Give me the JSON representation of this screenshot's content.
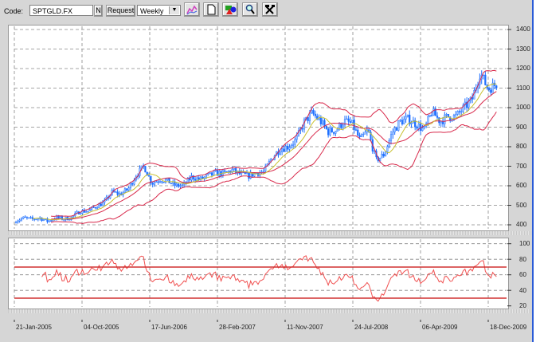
{
  "toolbar": {
    "code_label": "Code:",
    "code_value": "SPTGLD.FX",
    "n_button": "N",
    "request_button": "Request",
    "interval_value": "Weekly",
    "icons": [
      "indicator-chart-icon",
      "new-page-icon",
      "color-shapes-icon",
      "zoom-icon",
      "tools-icon"
    ]
  },
  "price_axis": {
    "ticks": [
      "1400",
      "1300",
      "1200",
      "1100",
      "1000",
      "900",
      "800",
      "700",
      "600",
      "500",
      "400"
    ]
  },
  "rsi_axis": {
    "ticks": [
      "100",
      "80",
      "60",
      "40",
      "20"
    ]
  },
  "date_axis": {
    "ticks": [
      "21-Jan-2005",
      "04-Oct-2005",
      "17-Jun-2006",
      "28-Feb-2007",
      "11-Nov-2007",
      "24-Jul-2008",
      "06-Apr-2009",
      "18-Dec-2009"
    ]
  },
  "colors": {
    "candles": "#1e6fff",
    "ma_short": "#c8c030",
    "bands": "#d8284a",
    "rsi": "#f05050",
    "rsi_levels": "#d03030"
  },
  "chart_data": [
    {
      "type": "candlestick",
      "title": "SPTGLD.FX Weekly",
      "period": "Weekly",
      "x_start": "21-Jan-2005",
      "x_end": "Jan-2010",
      "ylim": [
        400,
        1400
      ],
      "grid": true,
      "monthly_close_approx": [
        422,
        435,
        428,
        435,
        418,
        437,
        430,
        438,
        470,
        470,
        495,
        513,
        568,
        556,
        582,
        654,
        700,
        613,
        633,
        623,
        599,
        604,
        646,
        632,
        650,
        665,
        662,
        680,
        660,
        650,
        665,
        672,
        743,
        790,
        800,
        834,
        923,
        971,
        933,
        877,
        885,
        930,
        918,
        833,
        884,
        730,
        760,
        870,
        928,
        942,
        916,
        884,
        980,
        930,
        955,
        955,
        1000,
        1040,
        1180,
        1095,
        1120
      ],
      "overlays": [
        "Moving average (10)",
        "Bollinger Bands (20, 2)"
      ]
    },
    {
      "type": "line",
      "title": "RSI (14)",
      "ylim": [
        20,
        100
      ],
      "levels": [
        30,
        70
      ]
    }
  ]
}
